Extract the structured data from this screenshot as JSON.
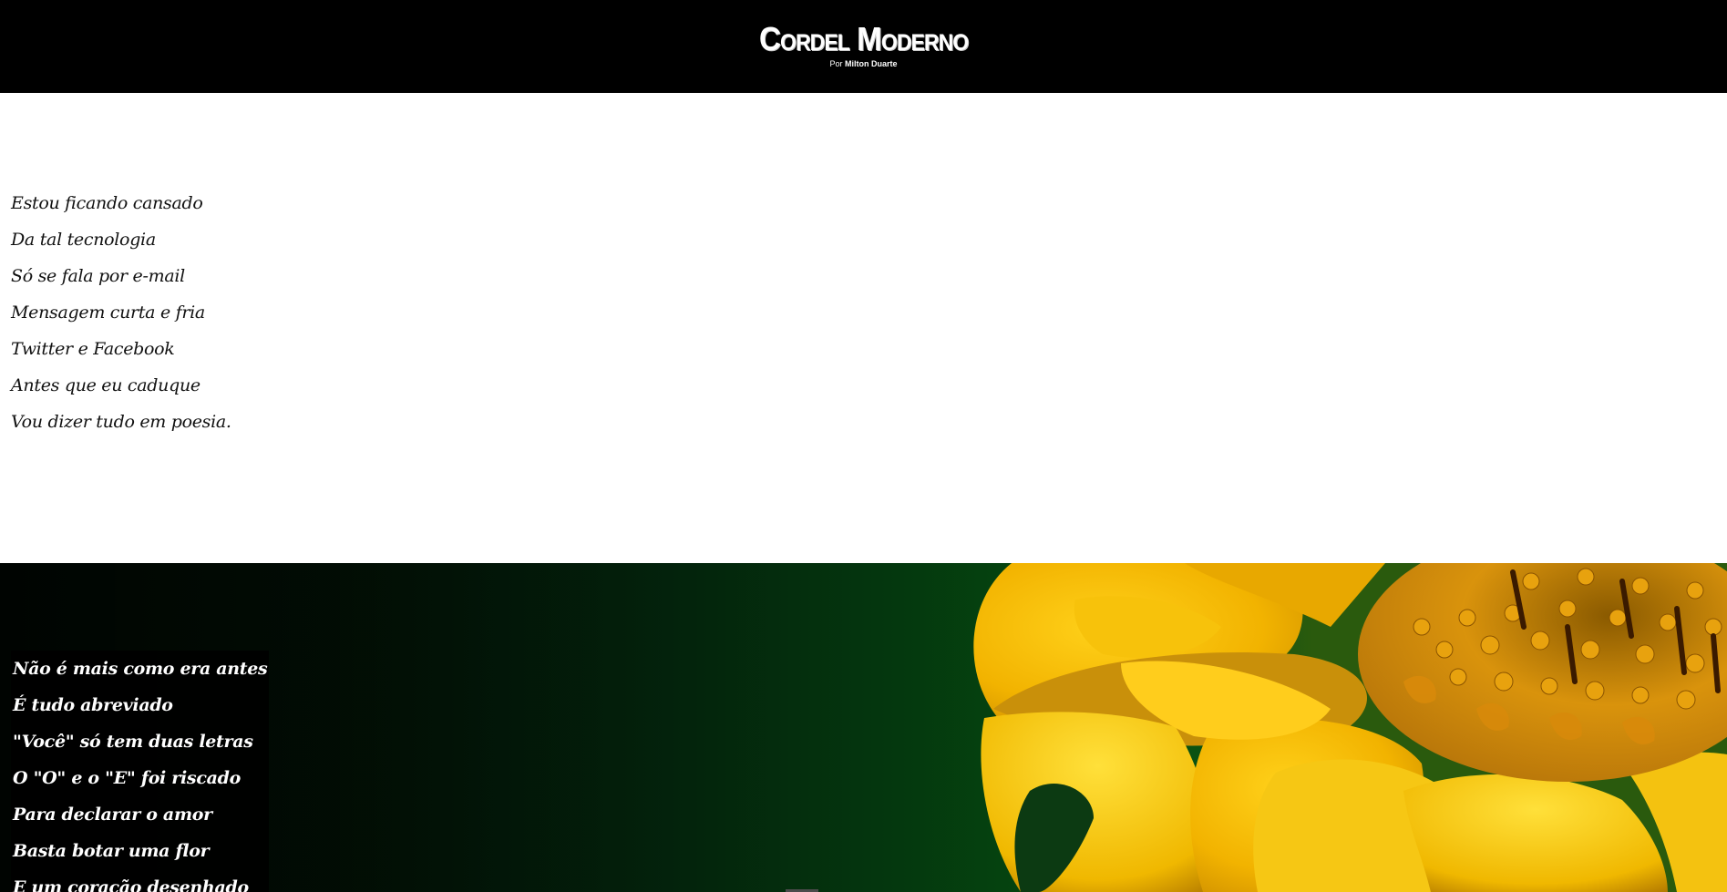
{
  "header": {
    "title_first_cap": "C",
    "title_first_rest": "ordel",
    "title_second_cap": "M",
    "title_second_rest": "oderno",
    "byline_prefix": "Por",
    "byline_author": "Milton Duarte"
  },
  "stanza_1": [
    "Estou ficando cansado",
    "Da tal tecnologia",
    "Só se fala por e-mail",
    "Mensagem curta e fria",
    "Twitter e Facebook",
    "Antes que eu caduque",
    "Vou dizer tudo em poesia."
  ],
  "stanza_2": [
    "Não é mais como era antes",
    "É tudo abreviado",
    "\"Você\" só tem duas letras",
    "O \"O\" e o \"E\" foi riscado",
    "Para declarar o amor",
    "Basta botar uma flor",
    "E um coração desenhado"
  ],
  "colors": {
    "header_bg": "#000000",
    "page_bg": "#ffffff",
    "verse_text": "#111111",
    "flower_yellow": "#f2c40a",
    "leaf_green": "#0a5312"
  }
}
